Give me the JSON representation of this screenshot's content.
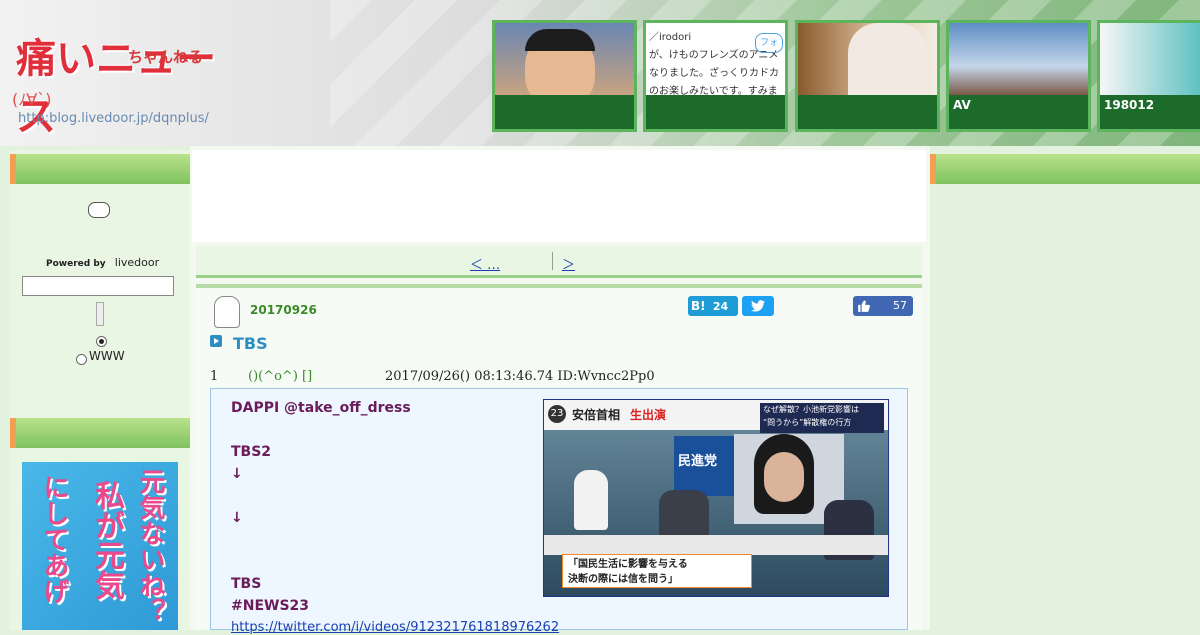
{
  "header": {
    "logo_main": "痛いニュース",
    "logo_sub": "ちゃんねる",
    "logo_face": "(ﾉ∀`)",
    "logo_url": "http:blog.livedoor.jp/dqnplus/",
    "thumbs": [
      {
        "caption": ""
      },
      {
        "caption": "",
        "text_lines": [
          "／irodori",
          "が、けものフレンズのアニメ",
          "なりました。ざっくりカドカ",
          "のお楽しみたいです。すみま"
        ],
        "follow": "フォ"
      },
      {
        "caption": ""
      },
      {
        "caption": "AV"
      },
      {
        "caption": "198012"
      }
    ]
  },
  "sidebar": {
    "powered_by": "Powered by",
    "livedoor": "livedoor",
    "radio_www": "WWW",
    "ad_text_1": "元気ないね？",
    "ad_text_2": "私が元気",
    "ad_text_3": "にしてあげ"
  },
  "pager": {
    "prev_label": "＜ …",
    "next_label": "＞"
  },
  "article": {
    "date": "20170926",
    "hatena_label": "B!",
    "hatena_count": "24",
    "like_count": "57",
    "title": "TBS",
    "comment": {
      "number": "1",
      "name": "()(^o^) []",
      "datetime": "2017/09/26() 08:13:46.74 ID:Wvncc2Pp0",
      "lines": [
        "DAPPI @take_off_dress",
        "TBS2",
        "↓",
        "↓",
        "TBS",
        "#NEWS23"
      ],
      "link": "https://twitter.com/i/videos/912321761818976262"
    }
  },
  "tv": {
    "channel": "23",
    "headline": "安倍首相",
    "live": "生出演",
    "top_right_1": "なぜ解散？小池新党影響は",
    "top_right_2": "“問うから”解散権の行方",
    "party": "民進党",
    "caption_1": "「国民生活に影響を与える",
    "caption_2": "決断の際には信を問う」"
  }
}
